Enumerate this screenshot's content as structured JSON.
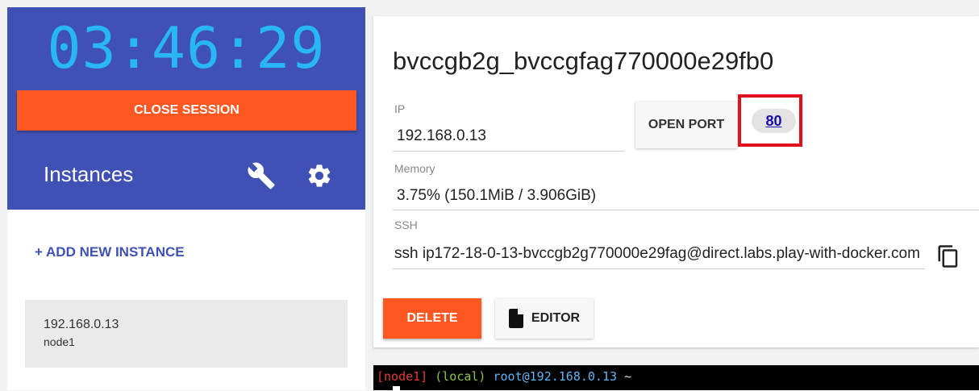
{
  "session": {
    "timer": "03:46:29",
    "close_label": "CLOSE SESSION"
  },
  "sidebar": {
    "title": "Instances",
    "add_instance_label": "+ ADD NEW INSTANCE",
    "instances": [
      {
        "ip": "192.168.0.13",
        "hostname": "node1"
      }
    ]
  },
  "instance_detail": {
    "name": "bvccgb2g_bvccgfag770000e29fb0",
    "ip_label": "IP",
    "ip_value": "192.168.0.13",
    "open_port_label": "OPEN PORT",
    "port": "80",
    "memory_label": "Memory",
    "memory_value": "3.75% (150.1MiB / 3.906GiB)",
    "ssh_label": "SSH",
    "ssh_value": "ssh ip172-18-0-13-bvccgb2g770000e29fag@direct.labs.play-with-docker.com",
    "delete_label": "DELETE",
    "editor_label": "EDITOR"
  },
  "terminal": {
    "node": "[node1]",
    "local": "(local)",
    "prompt": "root@192.168.0.13",
    "path": "~"
  },
  "colors": {
    "sidebar_header": "#3f51b5",
    "accent_orange": "#ff5722",
    "timer": "#29b6f6",
    "highlight_box": "#e0101a"
  },
  "icons": [
    "wrench-icon",
    "gear-icon",
    "copy-icon",
    "file-icon"
  ]
}
